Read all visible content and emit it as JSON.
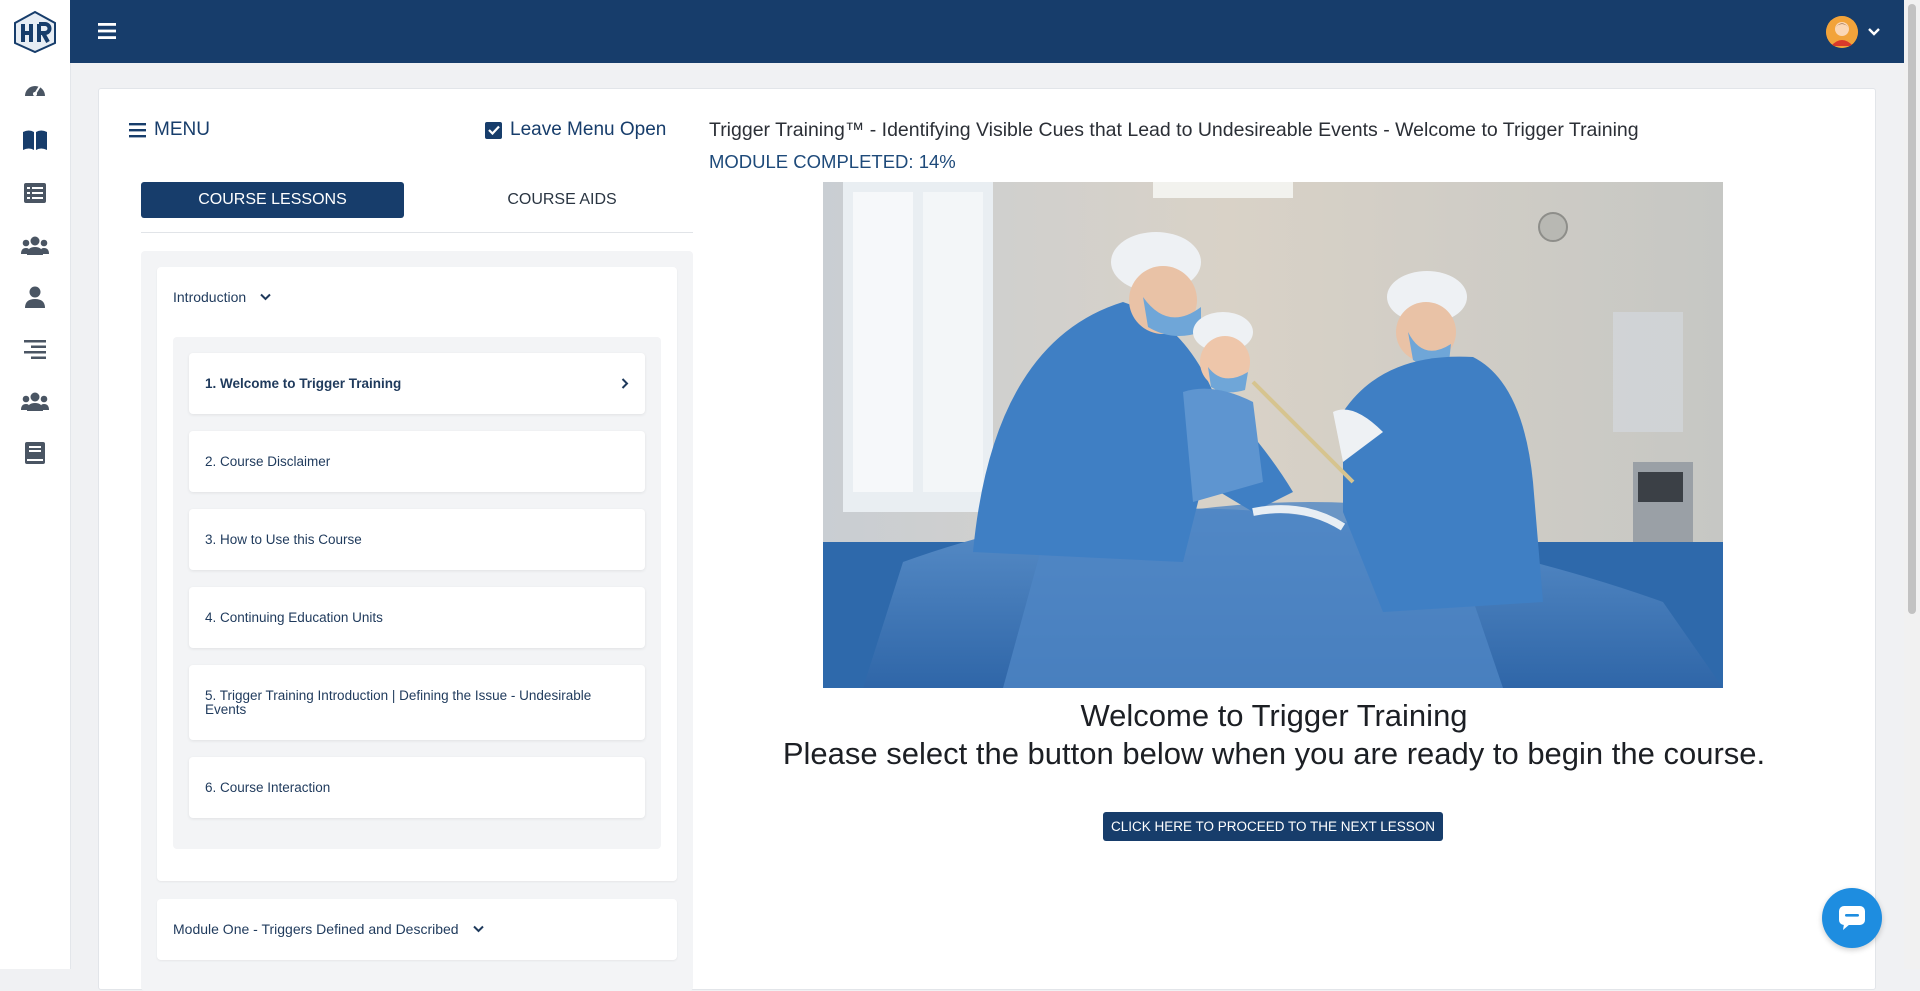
{
  "colors": {
    "primary": "#173d6b",
    "accent": "#1e8de0",
    "background": "#f0f1f3"
  },
  "rail": {
    "items": [
      {
        "icon": "dashboard-gauge-icon"
      },
      {
        "icon": "book-open-icon",
        "active": true
      },
      {
        "icon": "list-icon"
      },
      {
        "icon": "users-group-icon"
      },
      {
        "icon": "user-icon"
      },
      {
        "icon": "align-right-icon"
      },
      {
        "icon": "users-group-icon"
      },
      {
        "icon": "book-closed-icon"
      }
    ]
  },
  "menu": {
    "label": "MENU",
    "leave_open_label": "Leave Menu Open",
    "leave_open_checked": true
  },
  "tabs": {
    "lessons": "COURSE LESSONS",
    "aids": "COURSE AIDS"
  },
  "sections": [
    {
      "title": "Introduction",
      "lessons": [
        {
          "label": "1. Welcome to Trigger Training",
          "active": true
        },
        {
          "label": "2. Course Disclaimer"
        },
        {
          "label": "3. How to Use this Course"
        },
        {
          "label": "4. Continuing Education Units"
        },
        {
          "label": "5. Trigger Training Introduction | Defining the Issue - Undesirable Events"
        },
        {
          "label": "6. Course Interaction"
        }
      ]
    },
    {
      "title": "Module One - Triggers Defined and Described"
    }
  ],
  "content": {
    "title": "Trigger Training™ - Identifying Visible Cues that Lead to Undesireable Events - Welcome to Trigger Training",
    "progress": "MODULE COMPLETED: 14%",
    "progress_value": 14,
    "welcome_line1": "Welcome to Trigger Training",
    "welcome_line2": "Please select the button below when you are ready to begin the course.",
    "proceed_label": "CLICK HERE TO PROCEED TO THE NEXT LESSON"
  }
}
